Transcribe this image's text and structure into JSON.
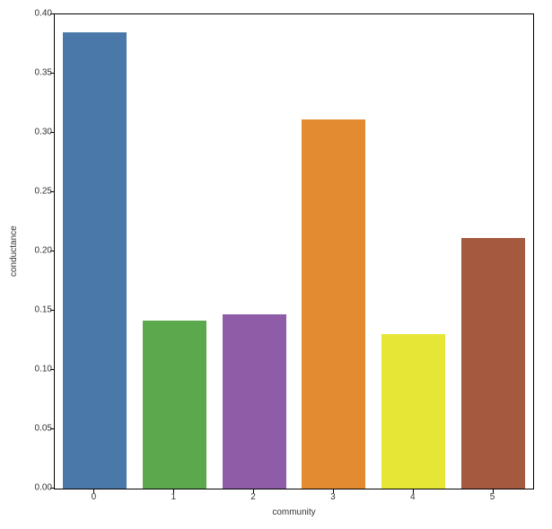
{
  "chart_data": {
    "type": "bar",
    "categories": [
      "0",
      "1",
      "2",
      "3",
      "4",
      "5"
    ],
    "values": [
      0.385,
      0.142,
      0.147,
      0.311,
      0.13,
      0.211
    ],
    "colors": [
      "#4A78A8",
      "#5CA84C",
      "#8F5CA8",
      "#E38B31",
      "#E6E637",
      "#A5593E"
    ],
    "xlabel": "community",
    "ylabel": "conductance",
    "ylim": [
      0.0,
      0.4
    ],
    "yticks": [
      "0.00",
      "0.05",
      "0.10",
      "0.15",
      "0.20",
      "0.25",
      "0.30",
      "0.35",
      "0.40"
    ]
  }
}
